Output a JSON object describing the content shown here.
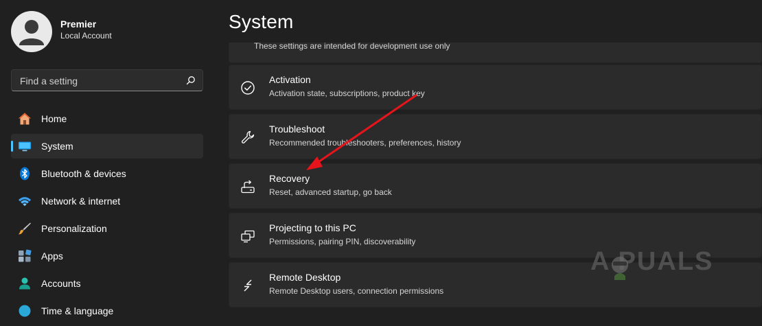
{
  "profile": {
    "name": "Premier",
    "account_type": "Local Account"
  },
  "search": {
    "placeholder": "Find a setting",
    "icon": "search-icon"
  },
  "nav": [
    {
      "label": "Home",
      "icon": "home-icon",
      "selected": false
    },
    {
      "label": "System",
      "icon": "monitor-icon",
      "selected": true
    },
    {
      "label": "Bluetooth & devices",
      "icon": "bluetooth-icon",
      "selected": false
    },
    {
      "label": "Network & internet",
      "icon": "wifi-icon",
      "selected": false
    },
    {
      "label": "Personalization",
      "icon": "brush-icon",
      "selected": false
    },
    {
      "label": "Apps",
      "icon": "apps-icon",
      "selected": false
    },
    {
      "label": "Accounts",
      "icon": "person-icon",
      "selected": false
    },
    {
      "label": "Time & language",
      "icon": "clock-icon",
      "selected": false
    }
  ],
  "main": {
    "title": "System",
    "partial_card_text": "These settings are intended for development use only",
    "cards": [
      {
        "title": "Activation",
        "subtitle": "Activation state, subscriptions, product key",
        "icon": "check-circle-icon"
      },
      {
        "title": "Troubleshoot",
        "subtitle": "Recommended troubleshooters, preferences, history",
        "icon": "wrench-icon"
      },
      {
        "title": "Recovery",
        "subtitle": "Reset, advanced startup, go back",
        "icon": "recovery-icon"
      },
      {
        "title": "Projecting to this PC",
        "subtitle": "Permissions, pairing PIN, discoverability",
        "icon": "projecting-icon"
      },
      {
        "title": "Remote Desktop",
        "subtitle": "Remote Desktop users, connection permissions",
        "icon": "remote-desktop-icon"
      }
    ]
  },
  "watermark": {
    "text": "A PUALS"
  },
  "colors": {
    "background": "#202020",
    "card": "#2b2b2b",
    "accent": "#4cc2ff",
    "annotation_arrow": "#e8141b"
  }
}
